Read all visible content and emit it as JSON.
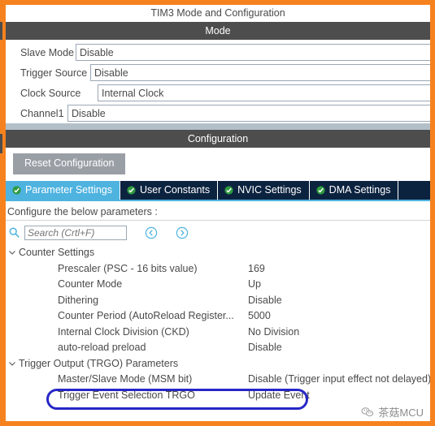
{
  "window": {
    "title": "TIM3 Mode and Configuration"
  },
  "mode_section": {
    "header": "Mode",
    "rows": [
      {
        "label": "Slave Mode",
        "value": "Disable",
        "label_width": 86,
        "name": "slave-mode"
      },
      {
        "label": "Trigger Source",
        "value": "Disable",
        "label_width": 104,
        "name": "trigger-source"
      },
      {
        "label": "Clock Source",
        "value": "Internal Clock",
        "label_width": 113,
        "name": "clock-source"
      },
      {
        "label": "Channel1",
        "value": "Disable",
        "label_width": 76,
        "name": "channel1"
      }
    ]
  },
  "config_section": {
    "header": "Configuration",
    "reset_button": "Reset Configuration",
    "tabs": [
      {
        "label": "Parameter Settings",
        "active": true,
        "icon": "check-circle-icon"
      },
      {
        "label": "User Constants",
        "active": false,
        "icon": "check-circle-icon"
      },
      {
        "label": "NVIC Settings",
        "active": false,
        "icon": "check-circle-icon"
      },
      {
        "label": "DMA Settings",
        "active": false,
        "icon": "check-circle-icon"
      }
    ],
    "configure_hint": "Configure the below parameters :",
    "search": {
      "placeholder": "Search (Crtl+F)",
      "value": "",
      "icon": "search-icon",
      "prev_icon": "chevron-left-circle-icon",
      "next_icon": "chevron-right-circle-icon"
    }
  },
  "parameter_tree": [
    {
      "type": "group",
      "label": "Counter Settings",
      "expanded": true,
      "name": "tree-group-counter-settings"
    },
    {
      "type": "item",
      "label": "Prescaler (PSC - 16 bits value)",
      "value": "169",
      "name": "tree-item-prescaler"
    },
    {
      "type": "item",
      "label": "Counter Mode",
      "value": "Up",
      "name": "tree-item-counter-mode"
    },
    {
      "type": "item",
      "label": "Dithering",
      "value": "Disable",
      "name": "tree-item-dithering"
    },
    {
      "type": "item",
      "label": "Counter Period (AutoReload Register...",
      "value": "5000",
      "clipped": true,
      "name": "tree-item-counter-period"
    },
    {
      "type": "item",
      "label": "Internal Clock Division (CKD)",
      "value": "No Division",
      "name": "tree-item-clock-division"
    },
    {
      "type": "item",
      "label": "auto-reload preload",
      "value": "Disable",
      "name": "tree-item-auto-reload-preload"
    },
    {
      "type": "group",
      "label": "Trigger Output (TRGO) Parameters",
      "expanded": true,
      "name": "tree-group-trigger-output"
    },
    {
      "type": "item",
      "label": "Master/Slave Mode (MSM bit)",
      "value": "Disable (Trigger input effect not delayed)",
      "name": "tree-item-master-slave-mode"
    },
    {
      "type": "item",
      "label": "Trigger Event Selection TRGO",
      "value": "Update Event",
      "highlighted": true,
      "name": "tree-item-trigger-event-selection"
    }
  ],
  "annotation": {
    "shape": "rounded-rect",
    "color": "#2727c6",
    "targets": "Trigger Event Selection TRGO / Update Event"
  },
  "watermark": {
    "text": "茶菇MCU",
    "icon": "wechat-icon"
  },
  "colors": {
    "frame_orange": "#f6821f",
    "header_gray": "#4d4d4d",
    "tab_active": "#4fb3e0",
    "tab_inactive": "#0c2340",
    "button_gray": "#9a9fa6",
    "band_gray": "#b3bfc8",
    "text_gray": "#4a4a4a",
    "annotation_blue": "#2727c6"
  }
}
